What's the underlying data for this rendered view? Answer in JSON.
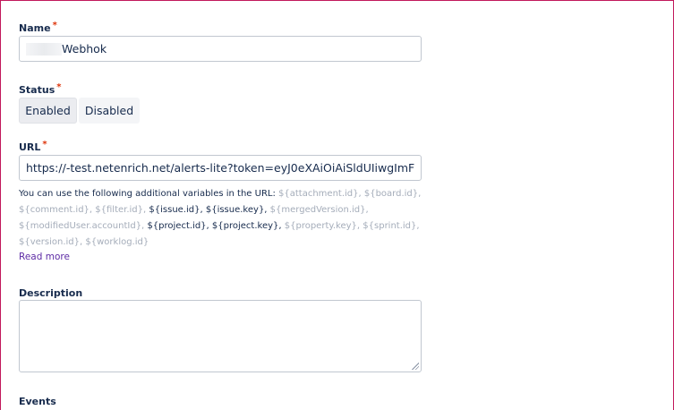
{
  "form": {
    "name_label": "Name",
    "name_value": "Webhok",
    "status_label": "Status",
    "status_enabled": "Enabled",
    "status_disabled": "Disabled",
    "url_label": "URL",
    "url_prefix": "https://",
    "url_value": "-test.netenrich.net/alerts-lite?token=eyJ0eXAiOiAiSldUIiwgImF",
    "help_intro": "You can use the following additional variables in the URL:",
    "vars": [
      {
        "text": "${attachment.id},",
        "active": false
      },
      {
        "text": "${board.id},",
        "active": false
      },
      {
        "text": "${comment.id},",
        "active": false
      },
      {
        "text": "${filter.id},",
        "active": false
      },
      {
        "text": "${issue.id},",
        "active": true
      },
      {
        "text": "${issue.key},",
        "active": true
      },
      {
        "text": "${mergedVersion.id},",
        "active": false
      },
      {
        "text": "${modifiedUser.accountId},",
        "active": false
      },
      {
        "text": "${project.id},",
        "active": true
      },
      {
        "text": "${project.key},",
        "active": true
      },
      {
        "text": "${property.key},",
        "active": false
      },
      {
        "text": "${sprint.id},",
        "active": false
      },
      {
        "text": "${version.id},",
        "active": false
      },
      {
        "text": "${worklog.id}",
        "active": false
      }
    ],
    "read_more": "Read more",
    "description_label": "Description",
    "events_label": "Events",
    "required_mark": "*"
  },
  "colors": {
    "frame_border": "#c2185b",
    "required": "#de350b",
    "link": "#5e2ca5",
    "dim_text": "#a5adba"
  }
}
